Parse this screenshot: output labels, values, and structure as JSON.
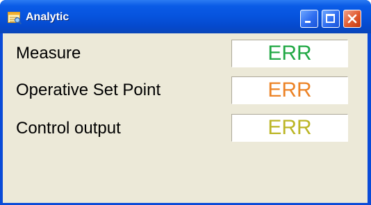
{
  "window": {
    "title": "Analytic",
    "icon": "analytic-app-icon",
    "buttons": {
      "minimize_icon": "minimize-icon",
      "maximize_icon": "maximize-icon",
      "close_icon": "close-icon"
    }
  },
  "rows": [
    {
      "label": "Measure",
      "value": "ERR",
      "value_color": "#22a845"
    },
    {
      "label": "Operative Set Point",
      "value": "ERR",
      "value_color": "#ec8326"
    },
    {
      "label": "Control output",
      "value": "ERR",
      "value_color": "#bcb627"
    }
  ],
  "colors": {
    "titlebar": "#0653dd",
    "client_background": "#ece9d8",
    "close_button": "#e0592e"
  }
}
